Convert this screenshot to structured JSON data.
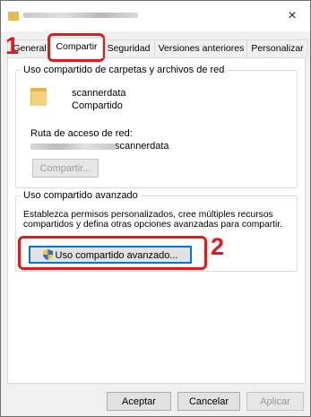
{
  "window": {
    "close_glyph": "×"
  },
  "tabs": [
    {
      "label": "General"
    },
    {
      "label": "Compartir"
    },
    {
      "label": "Seguridad"
    },
    {
      "label": "Versiones anteriores"
    },
    {
      "label": "Personalizar"
    }
  ],
  "network_sharing": {
    "group_label": "Uso compartido de carpetas y archivos de red",
    "folder_name": "scannerdata",
    "status": "Compartido",
    "path_label": "Ruta de acceso de red:",
    "path_value": "scannerdata",
    "share_button": "Compartir..."
  },
  "advanced_sharing": {
    "group_label": "Uso compartido avanzado",
    "description": "Establezca permisos personalizados, cree múltiples recursos compartidos y defina otras opciones avanzadas para compartir.",
    "button": "Uso compartido avanzado..."
  },
  "footer": {
    "accept": "Aceptar",
    "cancel": "Cancelar",
    "apply": "Aplicar"
  },
  "annotations": {
    "step1": "1",
    "step2": "2",
    "color": "#e01a1a"
  }
}
